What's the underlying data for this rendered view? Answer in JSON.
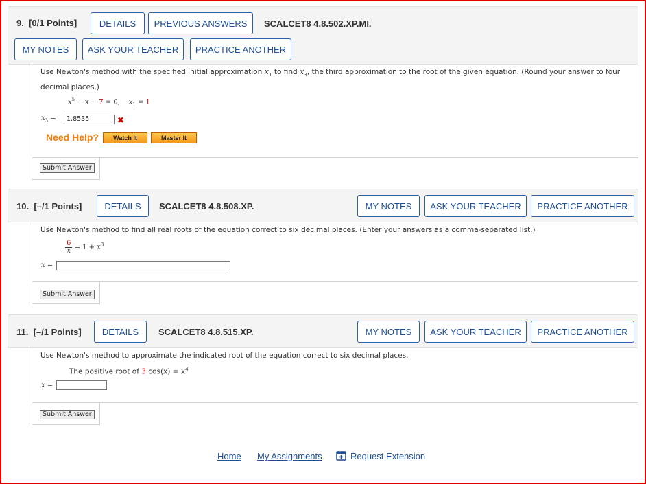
{
  "colors": {
    "frame": "#e00000",
    "link": "#1f4f93",
    "error": "#d40000",
    "help": "#e87f10"
  },
  "q9": {
    "number": "9.",
    "points": "[0/1 Points]",
    "details": "DETAILS",
    "previous_answers": "PREVIOUS ANSWERS",
    "code": "SCALCET8 4.8.502.XP.MI.",
    "my_notes": "MY NOTES",
    "ask_teacher": "ASK YOUR TEACHER",
    "practice": "PRACTICE ANOTHER",
    "prompt_a": "Use Newton's method with the specified initial approximation ",
    "prompt_x1": "x",
    "prompt_x1_sub": "1",
    "prompt_b": " to find ",
    "prompt_x3": "x",
    "prompt_x3_sub": "3",
    "prompt_c": ", the third approximation to the root of the given equation. (Round your answer to four decimal places.)",
    "eq_x": "x",
    "eq_exp": "5",
    "eq_mid": " − x − ",
    "eq_const": "7",
    "eq_end": " = 0,",
    "init_x": "x",
    "init_sub": "1",
    "init_eq": " = ",
    "init_val": "1",
    "answer_label_x": "x",
    "answer_label_sub": "3",
    "answer_label_eq": " =",
    "answer_value": "1.8535",
    "wrong_mark": "✖",
    "need_help": "Need Help?",
    "watch_it": "Watch It",
    "master_it": "Master It",
    "submit": "Submit Answer"
  },
  "q10": {
    "number": "10.",
    "points": "[–/1 Points]",
    "details": "DETAILS",
    "code": "SCALCET8 4.8.508.XP.",
    "my_notes": "MY NOTES",
    "ask_teacher": "ASK YOUR TEACHER",
    "practice": "PRACTICE ANOTHER",
    "prompt": "Use Newton's method to find all real roots of the equation correct to six decimal places. (Enter your answers as a comma-separated list.)",
    "frac_num": "6",
    "frac_den": "x",
    "eq_rhs": "= 1 + x",
    "eq_rhs_exp": "3",
    "answer_label": "x =",
    "answer_value": "",
    "submit": "Submit Answer"
  },
  "q11": {
    "number": "11.",
    "points": "[–/1 Points]",
    "details": "DETAILS",
    "code": "SCALCET8 4.8.515.XP.",
    "my_notes": "MY NOTES",
    "ask_teacher": "ASK YOUR TEACHER",
    "practice": "PRACTICE ANOTHER",
    "prompt": "Use Newton's method to approximate the indicated root of the equation correct to six decimal places.",
    "root_text": "The positive root of ",
    "coef": "3",
    "func": " cos(x) = x",
    "func_exp": "4",
    "answer_label": "x =",
    "answer_value": "",
    "submit": "Submit Answer"
  },
  "footer": {
    "home": "Home",
    "assignments": "My Assignments",
    "extension": "Request Extension"
  }
}
